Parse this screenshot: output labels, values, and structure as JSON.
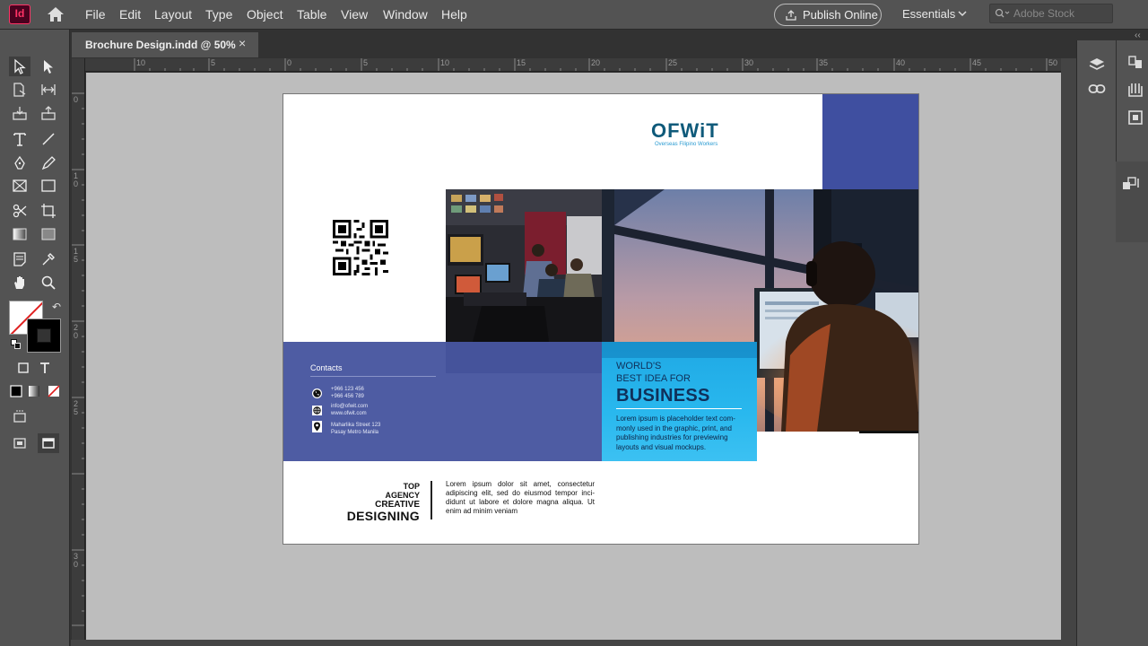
{
  "app": {
    "logo": "Id"
  },
  "menu": [
    "File",
    "Edit",
    "Layout",
    "Type",
    "Object",
    "Table",
    "View",
    "Window",
    "Help"
  ],
  "publish_label": "Publish Online",
  "workspace_label": "Essentials",
  "stock_search_placeholder": "Adobe Stock",
  "document_tab": {
    "title": "Brochure Design.indd @ 50%",
    "close": "×"
  },
  "ruler_top_labels": [
    "10",
    "5",
    "0",
    "5",
    "10",
    "15",
    "20",
    "25",
    "30",
    "35",
    "40",
    "45",
    "50"
  ],
  "ruler_left_labels": [
    "0",
    "1",
    "0",
    "1",
    "5",
    "2",
    "0",
    "2",
    "5",
    "3",
    "0"
  ],
  "brochure": {
    "logo": "OFWiT",
    "logo_subtitle": "Overseas Filipino Workers",
    "contacts_title": "Contacts",
    "contacts": [
      {
        "icon": "phone-icon",
        "lines": [
          "+966 123 456",
          "+966 456 789"
        ]
      },
      {
        "icon": "globe-icon",
        "lines": [
          "info@ofwit.com",
          "www.ofwit.com"
        ]
      },
      {
        "icon": "location-pin-icon",
        "lines": [
          "Maharlika Street 123",
          "Pasay Metro Manila"
        ]
      }
    ],
    "headline_1": "WORLD'S",
    "headline_2": "BEST IDEA FOR",
    "headline_big": "BUSINESS",
    "headline_body": "Lorem ipsum is placeholder text com-monly used in the graphic, print, and publishing industries for previewing layouts and visual mockups.",
    "tagline": [
      "TOP",
      "AGENCY",
      "CREATIVE",
      "DESIGNING"
    ],
    "lorem": "Lorem ipsum dolor sit amet, consectetur adipiscing elit, sed do eiusmod tempor inci-didunt ut labore et dolore magna aliqua. Ut enim ad minim veniam"
  },
  "colors": {
    "accent_blue": "#3f4fa0",
    "contact_blue": "#4e5ca3",
    "cyan": "#29b8ee",
    "app_bg": "#535353",
    "pasteboard": "#bdbdbd"
  }
}
